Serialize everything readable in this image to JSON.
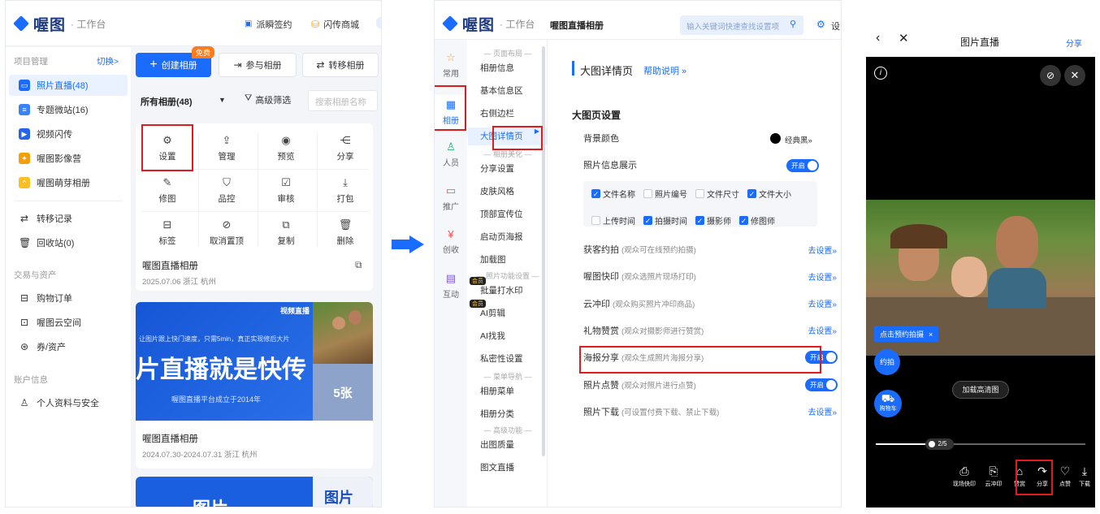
{
  "panel1": {
    "logo": {
      "name": "喔图",
      "workspace": "· 工作台"
    },
    "top_links": [
      "派瞬签约",
      "闪传商城"
    ],
    "sidebar": {
      "group1": "项目管理",
      "switch": "切换>",
      "items": [
        {
          "label": "照片直播(48)",
          "color": "#1a6cff"
        },
        {
          "label": "专题微站(16)",
          "color": "#3b82f6"
        },
        {
          "label": "视频闪传",
          "color": "#2563eb"
        },
        {
          "label": "喔图影像营",
          "color": "#f59e0b"
        },
        {
          "label": "喔图萌芽相册",
          "color": "#fbbf24"
        }
      ],
      "items2": [
        "转移记录",
        "回收站(0)"
      ],
      "group2": "交易与资产",
      "items3": [
        "购物订单",
        "喔图云空间",
        "券/资产"
      ],
      "group3": "账户信息",
      "items4": [
        "个人资料与安全"
      ]
    },
    "actions": {
      "create": "创建相册",
      "free_badge": "免费",
      "join": "参与相册",
      "transfer": "转移相册"
    },
    "filter": {
      "all": "所有相册(48)",
      "advanced": "高级筛选",
      "search_placeholder": "搜索相册名称"
    },
    "grid": [
      {
        "label": "设置",
        "icon": "settings-icon",
        "glyph": "⚙"
      },
      {
        "label": "管理",
        "icon": "upload-icon",
        "glyph": "⇪"
      },
      {
        "label": "预览",
        "icon": "eye-icon",
        "glyph": "◉"
      },
      {
        "label": "分享",
        "icon": "share-icon",
        "glyph": "⋲"
      },
      {
        "label": "修图",
        "icon": "wand-icon",
        "glyph": "✎"
      },
      {
        "label": "品控",
        "icon": "shield-icon",
        "glyph": "⛉"
      },
      {
        "label": "审核",
        "icon": "review-icon",
        "glyph": "☑"
      },
      {
        "label": "打包",
        "icon": "download-icon",
        "glyph": "⤓"
      },
      {
        "label": "标签",
        "icon": "tag-icon",
        "glyph": "⊟"
      },
      {
        "label": "取消置顶",
        "icon": "unpin-icon",
        "glyph": "⊘"
      },
      {
        "label": "复制",
        "icon": "copy-icon",
        "glyph": "⧉"
      },
      {
        "label": "删除",
        "icon": "trash-icon",
        "glyph": "🗑"
      }
    ],
    "album1": {
      "title": "喔图直播相册",
      "meta": "2025.07.06 浙江 杭州"
    },
    "banner": {
      "badge": "视频直播",
      "small": "让图片跟上快门速度，只需5min，真正实现修后大片",
      "big": "片直播就是快传",
      "sub": "喔图直播平台成立于2014年",
      "count": "5张"
    },
    "album2": {
      "title": "喔图直播相册",
      "meta": "2024.07.30-2024.07.31 浙江 杭州"
    },
    "banner2": {
      "text": "图片",
      "side": "图片 分享"
    }
  },
  "panel2": {
    "logo": {
      "name": "喔图",
      "workspace": "· 工作台"
    },
    "album_title": "喔图直播相册",
    "search_placeholder": "输入关键词快速查找设置项",
    "settings_cut": "设",
    "nav": [
      {
        "label": "常用",
        "glyph": "☆"
      },
      {
        "label": "相册",
        "glyph": "▦"
      },
      {
        "label": "人员",
        "glyph": "♙"
      },
      {
        "label": "推广",
        "glyph": "▭"
      },
      {
        "label": "创收",
        "glyph": "¥"
      },
      {
        "label": "互动",
        "glyph": "▤"
      }
    ],
    "mid": {
      "sec1": "— 页面布局 —",
      "items1": [
        "相册信息",
        "基本信息区",
        "右侧边栏",
        "大图详情页"
      ],
      "sec2": "— 相册美化 —",
      "items2": [
        "分享设置",
        "皮肤风格",
        "顶部宣传位",
        "启动页海报",
        "加载图"
      ],
      "sec3": "— 照片功能设置 —",
      "items3": [
        "批量打水印",
        "AI剪辑",
        "AI找我",
        "私密性设置"
      ],
      "vip": "会员",
      "sec4": "— 菜单导航 —",
      "items4": [
        "相册菜单",
        "相册分类"
      ],
      "sec5": "— 高级功能 —",
      "items5": [
        "出图质量",
        "图文直播"
      ]
    },
    "main": {
      "title": "大图详情页",
      "help": "帮助说明 »",
      "section": "大图页设置",
      "bg_label": "背景颜色",
      "bg_value": "经典黑»",
      "info_label": "照片信息展示",
      "on": "开启",
      "checks": [
        {
          "label": "文件名称",
          "on": true
        },
        {
          "label": "照片编号",
          "on": false
        },
        {
          "label": "文件尺寸",
          "on": false
        },
        {
          "label": "文件大小",
          "on": true
        },
        {
          "label": "上传时间",
          "on": false
        },
        {
          "label": "拍摄时间",
          "on": true
        },
        {
          "label": "摄影师",
          "on": true
        },
        {
          "label": "修图师",
          "on": true
        }
      ],
      "rows": [
        {
          "label": "获客约拍",
          "sub": "(观众可在线预约拍摄)",
          "action": "去设置»",
          "toggle": false
        },
        {
          "label": "喔图快印",
          "sub": "(观众选照片现场打印)",
          "action": "去设置»",
          "toggle": false
        },
        {
          "label": "云冲印",
          "sub": "(观众购买照片冲印商品)",
          "action": "去设置»",
          "toggle": false
        },
        {
          "label": "礼物赞赏",
          "sub": "(观众对摄影师进行赞赏)",
          "action": "去设置»",
          "toggle": false
        },
        {
          "label": "海报分享",
          "sub": "(观众生成照片海报分享)",
          "action": "开启",
          "toggle": true
        },
        {
          "label": "照片点赞",
          "sub": "(观众对照片进行点赞)",
          "action": "开启",
          "toggle": true
        },
        {
          "label": "照片下载",
          "sub": "(可设置付费下载、禁止下载)",
          "action": "去设置»",
          "toggle": false
        }
      ]
    }
  },
  "panel3": {
    "title": "图片直播",
    "share": "分享",
    "booking": "点击预约拍摄",
    "yuepai": "约拍",
    "cart": "购物车",
    "hd": "加载高清图",
    "progress": "2/5",
    "progress_value": 0.25,
    "toolbar": [
      {
        "label": "现场快印",
        "glyph": "⎙"
      },
      {
        "label": "云冲印",
        "glyph": "⎘"
      },
      {
        "label": "赞赏",
        "glyph": "⌂"
      },
      {
        "label": "分享",
        "glyph": "↷"
      },
      {
        "label": "点赞",
        "glyph": "♡"
      },
      {
        "label": "下载",
        "glyph": "⤓"
      }
    ]
  }
}
